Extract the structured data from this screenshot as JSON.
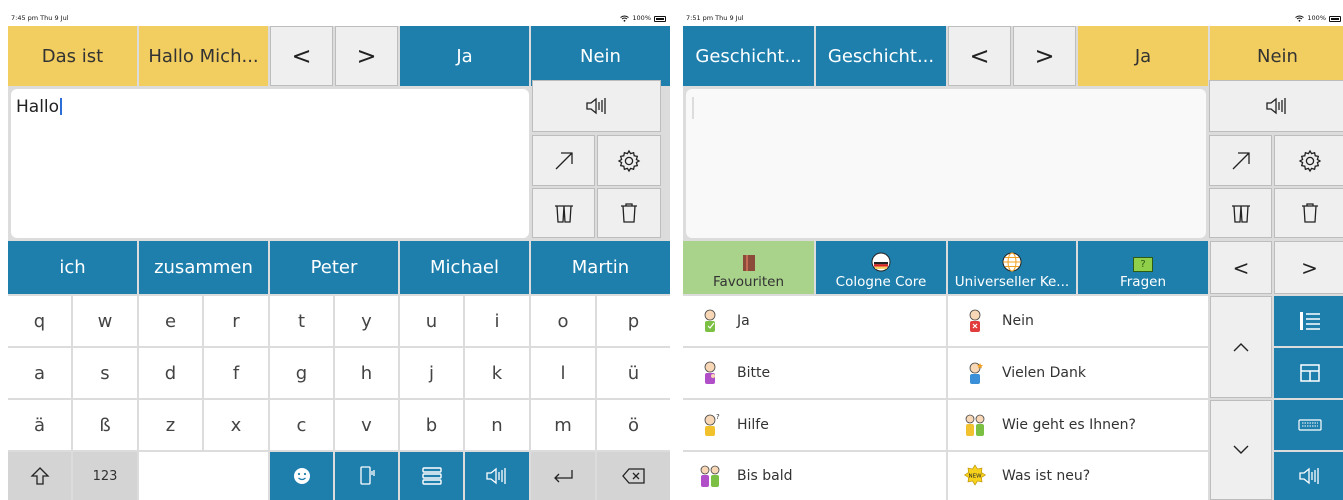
{
  "left": {
    "status": {
      "time": "7:45 pm  Thu 9 Jul",
      "battery": "100%"
    },
    "top": {
      "b1": "Das ist",
      "b2": "Hallo Mich...",
      "prev": "<",
      "next": ">",
      "yes": "Ja",
      "no": "Nein"
    },
    "text_value": "Hallo",
    "predictions": [
      "ich",
      "zusammen",
      "Peter",
      "Michael",
      "Martin"
    ],
    "keys": [
      [
        "q",
        "w",
        "e",
        "r",
        "t",
        "y",
        "u",
        "i",
        "o",
        "p"
      ],
      [
        "a",
        "s",
        "d",
        "f",
        "g",
        "h",
        "j",
        "k",
        "l",
        "ü"
      ],
      [
        "ä",
        "ß",
        "z",
        "x",
        "c",
        "v",
        "b",
        "n",
        "m",
        "ö"
      ]
    ],
    "numbers_key": "123"
  },
  "right": {
    "status": {
      "time": "7:51 pm  Thu 9 Jul",
      "battery": "100%"
    },
    "top": {
      "b1": "Geschicht...",
      "b2": "Geschicht...",
      "prev": "<",
      "next": ">",
      "yes": "Ja",
      "no": "Nein"
    },
    "categories": [
      {
        "label": "Favouriten",
        "icon": "book-icon"
      },
      {
        "label": "Cologne Core",
        "icon": "globe-flag-icon"
      },
      {
        "label": "Universeller Ke...",
        "icon": "globe-icon"
      },
      {
        "label": "Fragen",
        "icon": "question-bubble-icon",
        "badge": "?"
      }
    ],
    "cat_prev": "<",
    "cat_next": ">",
    "phrases": [
      {
        "label": "Ja"
      },
      {
        "label": "Nein"
      },
      {
        "label": "Bitte"
      },
      {
        "label": "Vielen Dank"
      },
      {
        "label": "Hilfe"
      },
      {
        "label": "Wie geht es Ihnen?"
      },
      {
        "label": "Bis bald"
      },
      {
        "label": "Was ist neu?",
        "badge": "NEW"
      }
    ]
  },
  "colors": {
    "yellow": "#f2cd5f",
    "blue": "#1e7fad",
    "green": "#a9d28b",
    "light": "#efefef"
  }
}
